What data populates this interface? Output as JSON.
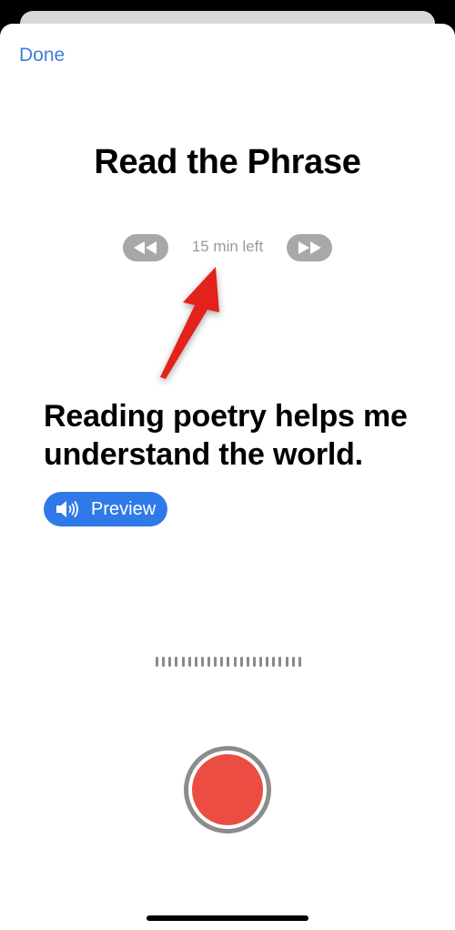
{
  "header": {
    "done_label": "Done"
  },
  "main": {
    "title": "Read the Phrase",
    "time_left": "15 min left",
    "phrase": "Reading poetry helps me understand the world.",
    "preview_label": "Preview"
  },
  "icons": {
    "prev": "rewind-icon",
    "next": "fast-forward-icon",
    "speaker": "speaker-icon",
    "annotation": "red-arrow-icon"
  },
  "colors": {
    "accent": "#3d7ee0",
    "preview_bg": "#2f7ae8",
    "record": "#ec4d42",
    "annotation_arrow": "#e3221b"
  },
  "recording": {
    "state": "idle"
  }
}
